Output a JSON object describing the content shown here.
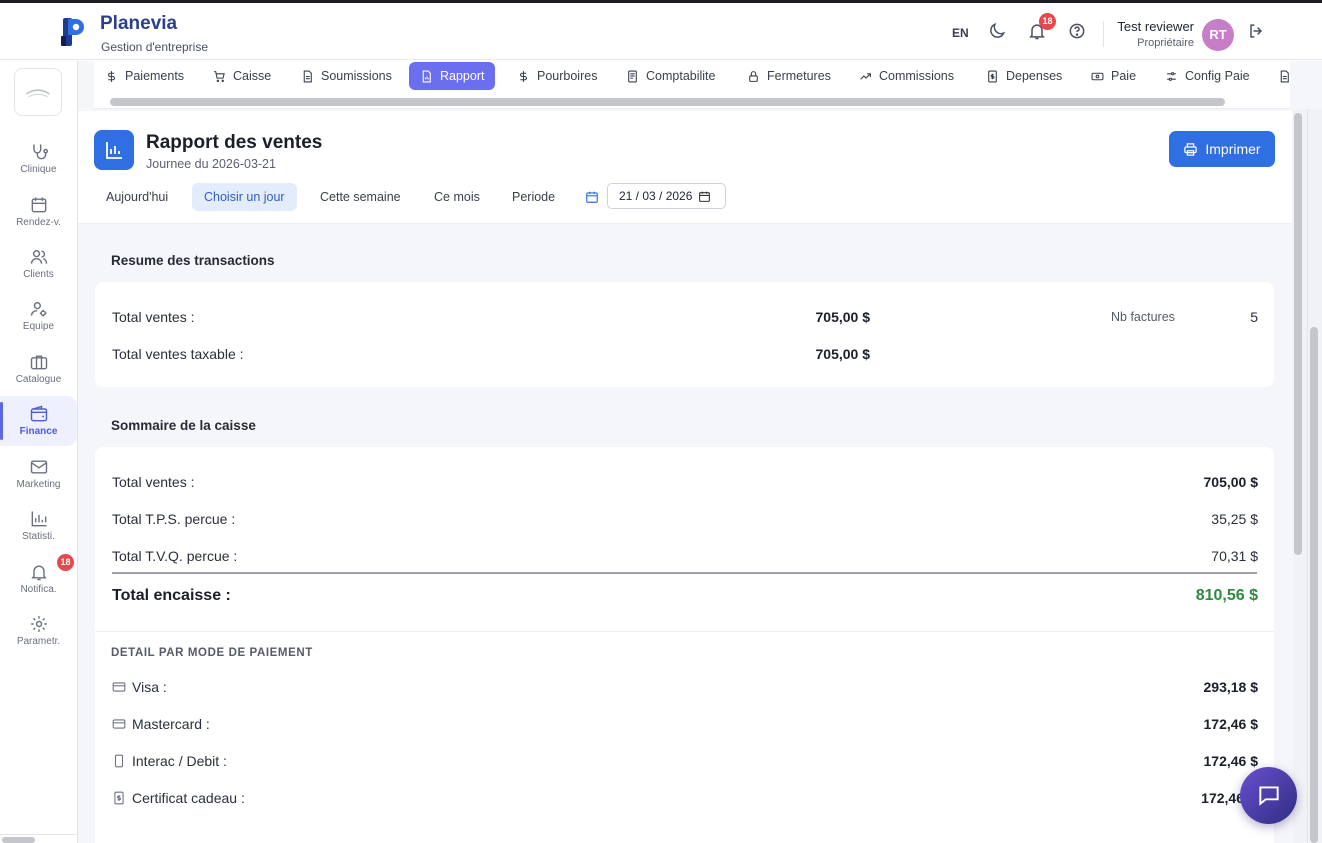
{
  "app": {
    "title": "Planevia",
    "subtitle": "Gestion d'entreprise"
  },
  "topbar": {
    "lang": "EN",
    "notif_count": "18",
    "user_name": "Test reviewer",
    "user_role": "Propriétaire",
    "avatar_initials": "RT"
  },
  "sidebar": {
    "items": [
      {
        "label": "Clinique",
        "icon": "stethoscope-icon"
      },
      {
        "label": "Rendez-v.",
        "icon": "calendar-icon"
      },
      {
        "label": "Clients",
        "icon": "users-icon"
      },
      {
        "label": "Equipe",
        "icon": "user-cog-icon"
      },
      {
        "label": "Catalogue",
        "icon": "briefcase-icon"
      },
      {
        "label": "Finance",
        "icon": "wallet-icon"
      },
      {
        "label": "Marketing",
        "icon": "mail-icon"
      },
      {
        "label": "Statisti.",
        "icon": "bar-chart-icon"
      },
      {
        "label": "Notifica.",
        "icon": "bell-icon"
      },
      {
        "label": "Parametr.",
        "icon": "gear-icon"
      }
    ],
    "active": "Finance",
    "notif_badge": "18"
  },
  "tabs": [
    {
      "label": "Paiements",
      "icon": "dollar-icon"
    },
    {
      "label": "Caisse",
      "icon": "cart-icon"
    },
    {
      "label": "Soumissions",
      "icon": "document-icon"
    },
    {
      "label": "Rapport",
      "icon": "report-icon"
    },
    {
      "label": "Pourboires",
      "icon": "dollar-icon"
    },
    {
      "label": "Comptabilite",
      "icon": "ledger-icon"
    },
    {
      "label": "Fermetures",
      "icon": "lock-icon"
    },
    {
      "label": "Commissions",
      "icon": "trend-icon"
    },
    {
      "label": "Depenses",
      "icon": "receipt-icon"
    },
    {
      "label": "Paie",
      "icon": "banknote-icon"
    },
    {
      "label": "Config Paie",
      "icon": "sliders-icon"
    }
  ],
  "active_tab": "Rapport",
  "report": {
    "title": "Rapport des ventes",
    "subtitle": "Journee du 2026-03-21",
    "print_label": "Imprimer",
    "periods": [
      "Aujourd'hui",
      "Choisir un jour",
      "Cette semaine",
      "Ce mois",
      "Periode"
    ],
    "active_period": "Choisir un jour",
    "date_value": "21 / 03 / 2026"
  },
  "transactions": {
    "title": "Resume des transactions",
    "total_sales_label": "Total ventes :",
    "total_sales_value": "705,00 $",
    "taxable_label": "Total ventes taxable :",
    "taxable_value": "705,00 $",
    "nb_invoices_label": "Nb factures",
    "nb_invoices_value": "5"
  },
  "cash": {
    "title": "Sommaire de la caisse",
    "total_sales_label": "Total ventes :",
    "total_sales_value": "705,00 $",
    "tps_label": "Total T.P.S. percue :",
    "tps_value": "35,25 $",
    "tvq_label": "Total T.V.Q. percue :",
    "tvq_value": "70,31 $",
    "total_label": "Total encaisse :",
    "total_value": "810,56 $"
  },
  "payment_modes": {
    "title": "DETAIL PAR MODE DE PAIEMENT",
    "items": [
      {
        "label": "Visa :",
        "value": "293,18 $",
        "icon": "credit-card-icon"
      },
      {
        "label": "Mastercard :",
        "value": "172,46 $",
        "icon": "credit-card-icon"
      },
      {
        "label": "Interac / Debit :",
        "value": "172,46 $",
        "icon": "phone-icon"
      },
      {
        "label": "Certificat cadeau :",
        "value": "172,46",
        "icon": "gift-certificate-icon"
      }
    ]
  },
  "colors": {
    "primary": "#2f6ee3",
    "active_tab": "#6a6ff0",
    "total_green": "#2d8a3e",
    "badge": "#e5484d"
  }
}
